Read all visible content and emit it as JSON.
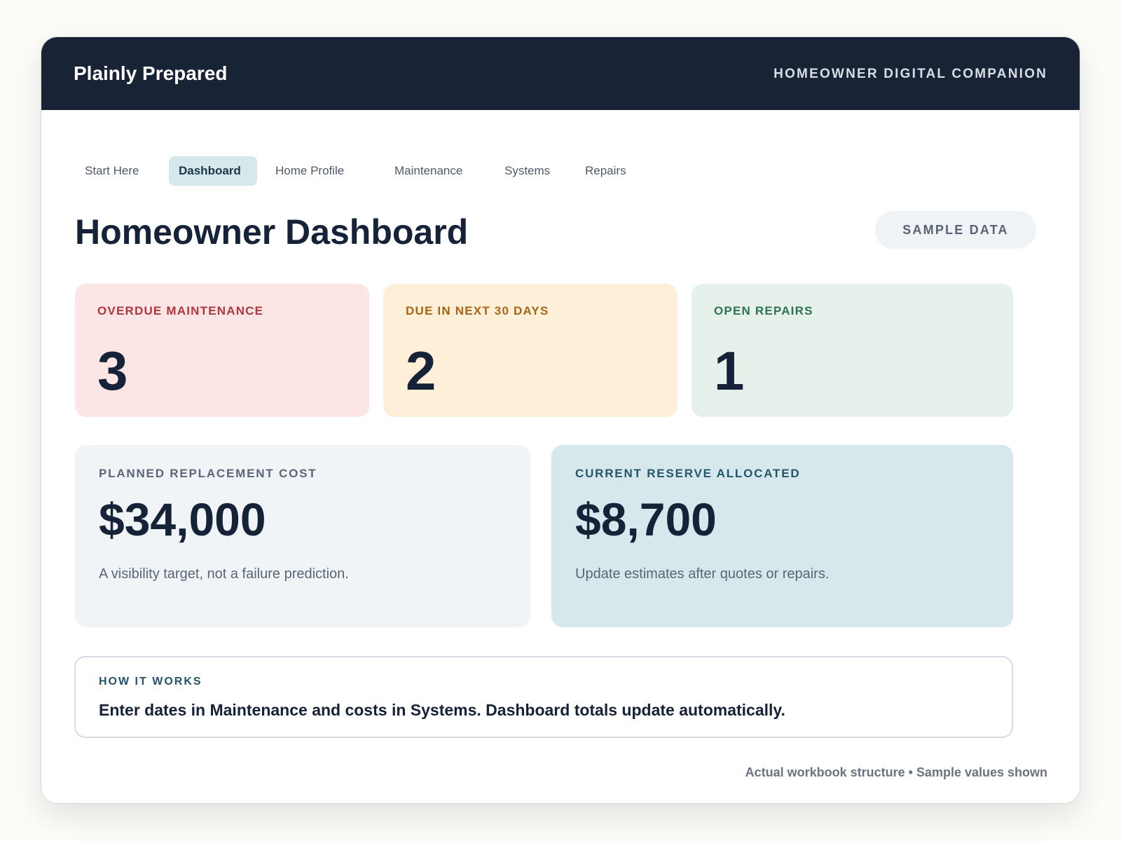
{
  "app": {
    "brand": "Plainly Prepared",
    "tagline": "HOMEOWNER DIGITAL COMPANION"
  },
  "nav": {
    "tabs": [
      {
        "label": "Start Here",
        "active": false
      },
      {
        "label": "Dashboard",
        "active": true
      },
      {
        "label": "Home Profile",
        "active": false
      },
      {
        "label": "Maintenance",
        "active": false
      },
      {
        "label": "Systems",
        "active": false
      },
      {
        "label": "Repairs",
        "active": false
      }
    ]
  },
  "page": {
    "title": "Homeowner Dashboard",
    "badge": "SAMPLE DATA"
  },
  "metrics": [
    {
      "label": "OVERDUE MAINTENANCE",
      "value": "3"
    },
    {
      "label": "DUE IN NEXT 30 DAYS",
      "value": "2"
    },
    {
      "label": "OPEN REPAIRS",
      "value": "1"
    }
  ],
  "finance": {
    "planned": {
      "label": "PLANNED REPLACEMENT COST",
      "value": "$34,000",
      "note": "A visibility target, not a failure prediction."
    },
    "reserve": {
      "label": "CURRENT RESERVE ALLOCATED",
      "value": "$8,700",
      "note": "Update estimates after quotes or repairs."
    }
  },
  "how_it_works": {
    "label": "HOW IT WORKS",
    "text": "Enter dates in Maintenance and costs in Systems. Dashboard totals update automatically."
  },
  "footer": {
    "note": "Actual workbook structure • Sample values shown"
  },
  "colors": {
    "header_bg": "#182336",
    "overdue_bg": "#fbe5e5",
    "overdue_label": "#b1363c",
    "due_bg": "#fef0d8",
    "due_label": "#a76414",
    "repairs_bg": "#e6f1ec",
    "repairs_label": "#2d7350",
    "planned_bg": "#f0f4f7",
    "reserve_bg": "#d7e8ec",
    "reserve_label": "#22576a"
  }
}
